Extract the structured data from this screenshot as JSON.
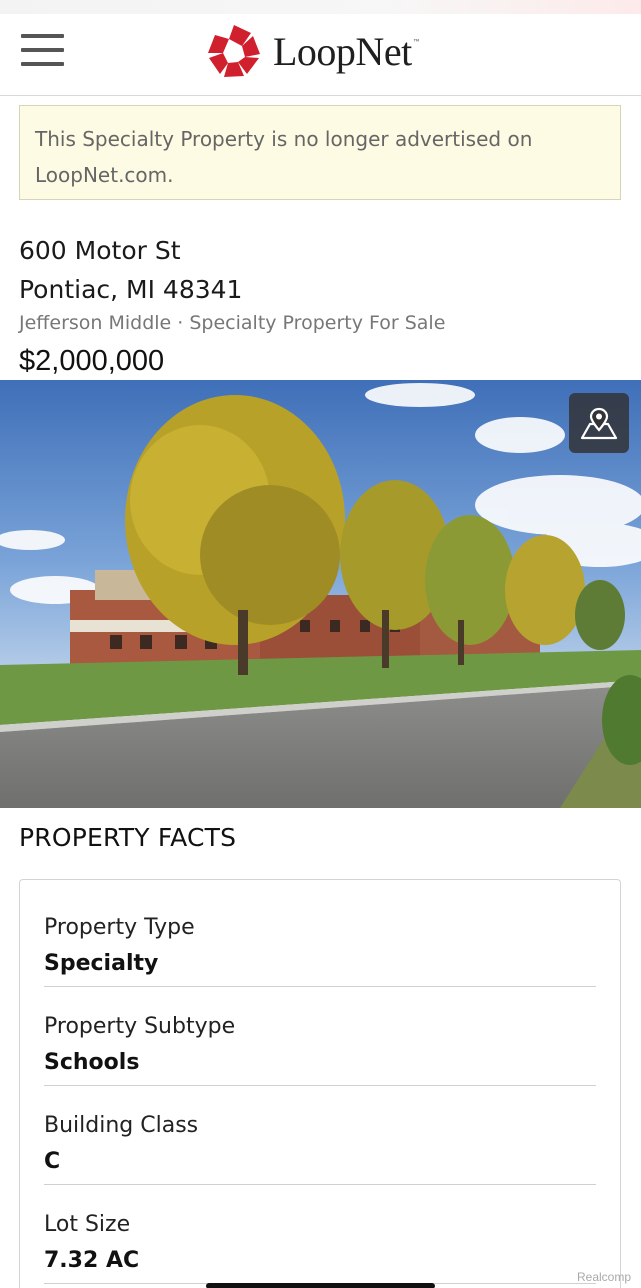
{
  "header": {
    "brand_name": "LoopNet",
    "brand_tm": "™",
    "brand_color": "#d0202e",
    "menu_icon": "hamburger-menu-icon"
  },
  "notice": {
    "text": "This Specialty Property is no longer advertised on LoopNet.com."
  },
  "listing": {
    "address_line1": "600 Motor St",
    "address_line2": "Pontiac, MI 48341",
    "subtitle": "Jefferson Middle · Specialty Property For Sale",
    "price": "$2,000,000",
    "map_icon": "map-pin-icon"
  },
  "photo": {
    "credit": "Realcomp"
  },
  "facts": {
    "heading": "PROPERTY FACTS",
    "items": [
      {
        "label": "Property Type",
        "value": "Specialty"
      },
      {
        "label": "Property Subtype",
        "value": "Schools"
      },
      {
        "label": "Building Class",
        "value": "C"
      },
      {
        "label": "Lot Size",
        "value": "7.32 AC"
      }
    ]
  }
}
